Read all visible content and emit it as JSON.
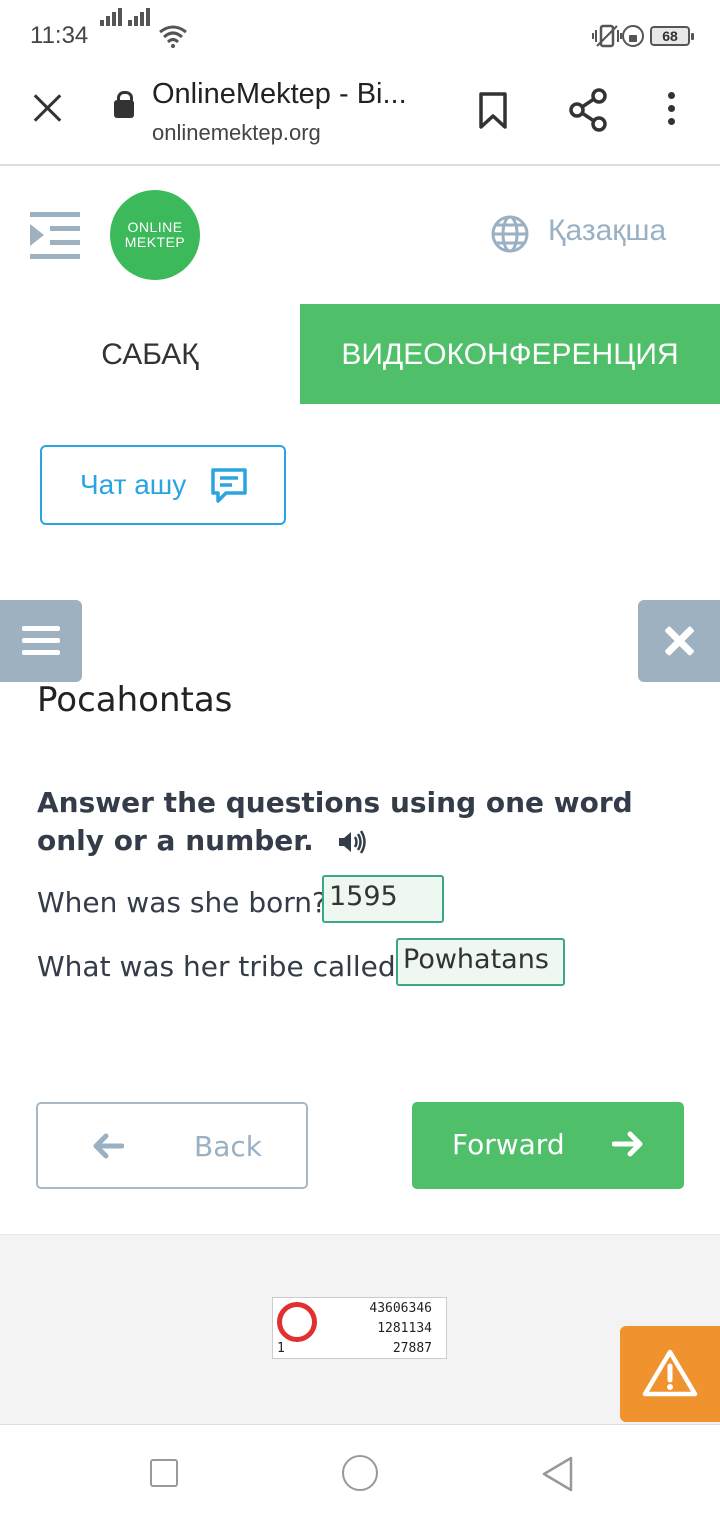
{
  "status_bar": {
    "time": "11:34",
    "battery": "68"
  },
  "browser": {
    "page_title": "OnlineMektep - Bi...",
    "url": "onlinemektep.org"
  },
  "site_header": {
    "logo_line1": "ONLINE",
    "logo_line2": "MEKTEP",
    "language_label": "Қазақша",
    "logo_color": "#3cb95a"
  },
  "tabs": [
    {
      "label": "САБАҚ",
      "active": true
    },
    {
      "label": "ВИДЕОКОНФЕРЕНЦИЯ",
      "active": false
    }
  ],
  "chat_button": {
    "label": "Чат ашу"
  },
  "lesson": {
    "title": "Pocahontas",
    "instruction": "Answer the questions using one word only or a number.",
    "questions": [
      {
        "text": "When was she born?",
        "answer": "1595"
      },
      {
        "text": "What was her tribe called?",
        "answer": "Powhatans"
      }
    ]
  },
  "navigation": {
    "back_label": "Back",
    "forward_label": "Forward"
  },
  "counter": {
    "line1": "43606346",
    "line2": "1281134",
    "line3": "27887",
    "line4_left": "1"
  },
  "colors": {
    "accent_green": "#4fbf6a",
    "chat_blue": "#2aa5e0",
    "muted_gray_blue": "#9db1c0",
    "warning_orange": "#f0922e"
  }
}
